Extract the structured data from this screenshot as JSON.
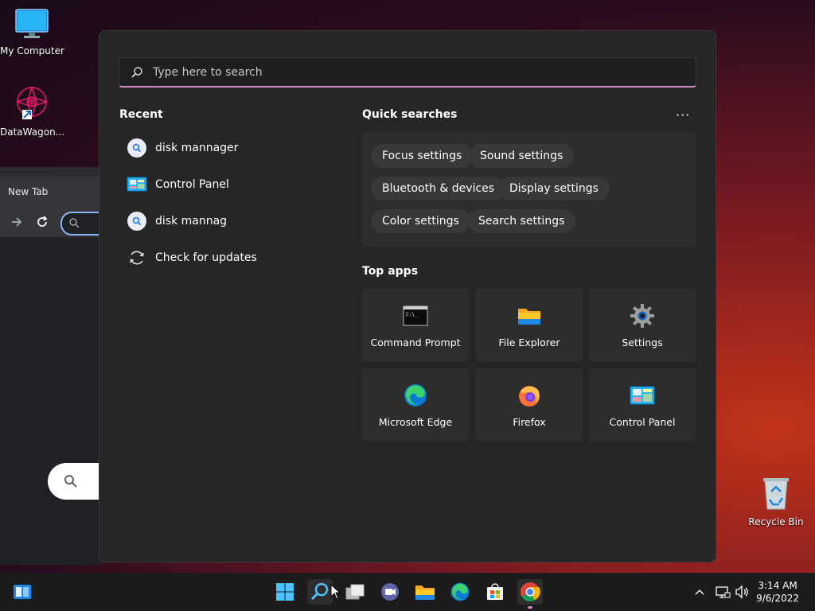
{
  "desktop": {
    "icons": [
      {
        "label": "My Computer"
      },
      {
        "label": "DataWagon..."
      },
      {
        "label": "Recycle Bin"
      }
    ]
  },
  "browser": {
    "tab_label": "New Tab"
  },
  "start_menu": {
    "search_placeholder": "Type here to search",
    "recent_title": "Recent",
    "recent_items": [
      {
        "label": "disk mannager",
        "icon": "search-icon"
      },
      {
        "label": "Control Panel",
        "icon": "control-panel-icon"
      },
      {
        "label": "disk mannag",
        "icon": "search-icon"
      },
      {
        "label": "Check for updates",
        "icon": "refresh-icon"
      }
    ],
    "quick_title": "Quick searches",
    "more_label": "···",
    "quick_searches": [
      "Focus settings",
      "Sound settings",
      "Bluetooth & devices",
      "Display settings",
      "Color settings",
      "Search settings"
    ],
    "top_apps_title": "Top apps",
    "top_apps": [
      {
        "label": "Command Prompt",
        "icon": "command-prompt-icon"
      },
      {
        "label": "File Explorer",
        "icon": "file-explorer-icon"
      },
      {
        "label": "Settings",
        "icon": "settings-gear-icon"
      },
      {
        "label": "Microsoft Edge",
        "icon": "edge-icon"
      },
      {
        "label": "Firefox",
        "icon": "firefox-icon"
      },
      {
        "label": "Control Panel",
        "icon": "control-panel-icon"
      }
    ]
  },
  "taskbar": {
    "time": "3:14 AM",
    "date": "9/6/2022"
  }
}
